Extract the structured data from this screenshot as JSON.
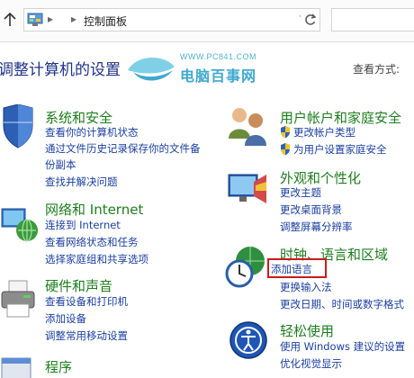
{
  "address": {
    "crumb": "控制面板",
    "separator": "▸",
    "refresh_icon": "refresh-icon",
    "up_icon": "up-arrow-icon"
  },
  "header": {
    "title": "调整计算机的设置",
    "view_label": "查看方式:"
  },
  "watermark": {
    "url": "WWW.PC841.COM",
    "name": "电脑百事网"
  },
  "categories": {
    "system": {
      "title": "系统和安全",
      "links": [
        "查看你的计算机状态",
        "通过文件历史记录保存你的文件备",
        "份副本",
        "查找并解决问题"
      ]
    },
    "network": {
      "title": "网络和 Internet",
      "links": [
        "连接到 Internet",
        "查看网络状态和任务",
        "选择家庭组和共享选项"
      ]
    },
    "hardware": {
      "title": "硬件和声音",
      "links": [
        "查看设备和打印机",
        "添加设备",
        "调整常用移动设置"
      ]
    },
    "programs": {
      "title": "程序"
    },
    "users": {
      "title": "用户帐户和家庭安全",
      "links": [
        "更改帐户类型",
        "为用户设置家庭安全"
      ]
    },
    "appearance": {
      "title": "外观和个性化",
      "links": [
        "更改主题",
        "更改桌面背景",
        "调整屏幕分辨率"
      ]
    },
    "clock": {
      "title": "时钟、语言和区域",
      "links": [
        "添加语言",
        "更换输入法",
        "更改日期、时间或数字格式"
      ]
    },
    "ease": {
      "title": "轻松使用",
      "links": [
        "使用 Windows 建议的设置",
        "优化视觉显示"
      ]
    }
  },
  "colors": {
    "title_blue": "#1e3287",
    "category_green": "#1e7e1e",
    "link_blue": "#1a3fa0",
    "highlight_red": "#c81c1c"
  }
}
